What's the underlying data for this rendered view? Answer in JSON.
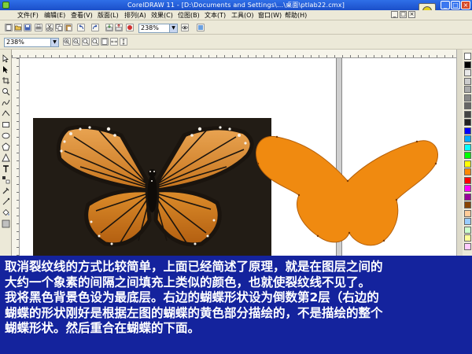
{
  "window": {
    "title": "CorelDRAW 11 - [D:\\Documents and Settings\\...\\桌面\\ptlab22.cmx]",
    "minimize_label": "_",
    "maximize_label": "□",
    "close_label": "×"
  },
  "menu": {
    "items": [
      "文件(F)",
      "编辑(E)",
      "查看(V)",
      "版面(L)",
      "排列(A)",
      "效果(C)",
      "位图(B)",
      "文本(T)",
      "工具(O)",
      "窗口(W)",
      "帮助(H)"
    ],
    "mdi_min": "_",
    "mdi_restore": "□",
    "mdi_close": "×"
  },
  "toolbar": {
    "zoom_value": "238%",
    "zoom_value_2": "238%"
  },
  "caption": {
    "lines": [
      "取消裂纹线的方式比较简单，上面已经简述了原理，就是在图层之间的",
      "大约一个象素的间隔之间填充上类似的颜色，也就使裂纹线不见了。",
      "我将黑色背景色设为最底层。右边的蝴蝶形状设为倒数第2层（右边的",
      "蝴蝶的形状刚好是根据左图的蝴蝶的黄色部分描绘的，不是描绘的整个",
      "蝴蝶形状。然后重合在蝴蝶的下面。"
    ]
  },
  "colors": {
    "title_bar": "#1b4fc9",
    "caption_bg": "#14239d",
    "butterfly_fill": "#f08a10",
    "photo_bg": "#221c15"
  },
  "palette": [
    "#ffffff",
    "#000000",
    "#e8e8e8",
    "#cccccc",
    "#aaaaaa",
    "#888888",
    "#666666",
    "#444444",
    "#222222",
    "#0000ff",
    "#00aaff",
    "#00ffff",
    "#00ff00",
    "#ffff00",
    "#ff8800",
    "#ff0000",
    "#ff00ff",
    "#990099",
    "#884400",
    "#ffcc99",
    "#99ccff",
    "#ccffcc",
    "#ffff99",
    "#ffccff"
  ],
  "icons": [
    "new-icon",
    "open-icon",
    "save-icon",
    "print-icon",
    "cut-icon",
    "copy-icon",
    "paste-icon",
    "undo-icon",
    "redo-icon",
    "import-icon",
    "export-icon",
    "zoom-in-icon",
    "zoom-out-icon",
    "pick-tool-icon",
    "shape-tool-icon",
    "zoom-tool-icon",
    "freehand-tool-icon",
    "rectangle-tool-icon",
    "ellipse-tool-icon",
    "polygon-tool-icon",
    "text-tool-icon",
    "fill-tool-icon",
    "outline-tool-icon"
  ]
}
